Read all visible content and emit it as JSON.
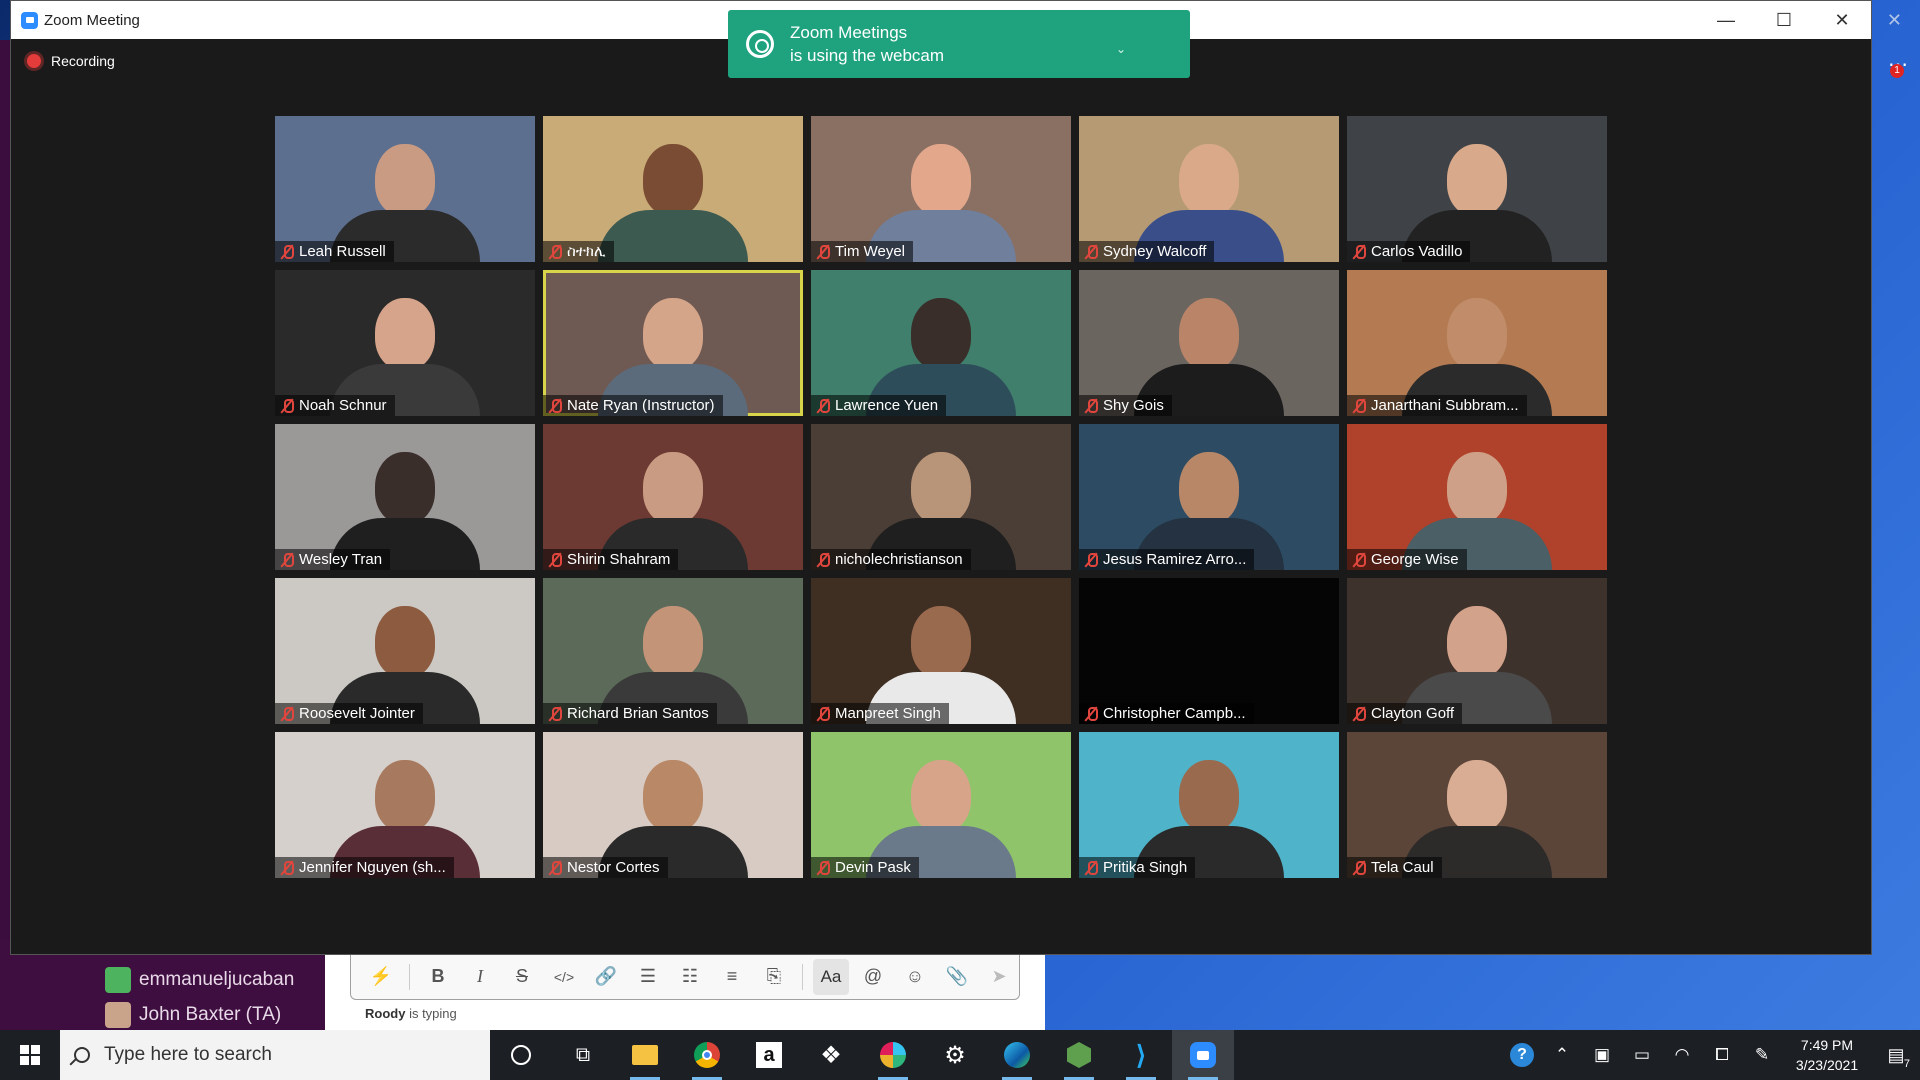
{
  "window": {
    "title": "Zoom Meeting"
  },
  "recording": {
    "label": "Recording"
  },
  "notification": {
    "line1": "Zoom Meetings",
    "line2": "is using the webcam"
  },
  "side_badge": "1",
  "participants": [
    {
      "name": "Leah Russell",
      "bg": "#5d6f8f",
      "head": "#c99b82",
      "body": "#2b2b2b"
    },
    {
      "name": "ስተክሊ",
      "bg": "#c9ab78",
      "head": "#7a4c33",
      "body": "#3c5a4f"
    },
    {
      "name": "Tim Weyel",
      "bg": "#8a6f63",
      "head": "#e3a88c",
      "body": "#6f7f9c"
    },
    {
      "name": "Sydney Walcoff",
      "bg": "#b59a74",
      "head": "#d9a98a",
      "body": "#3a4f8a"
    },
    {
      "name": "Carlos Vadillo",
      "bg": "#3f4347",
      "head": "#d8a98a",
      "body": "#222"
    },
    {
      "name": "Noah Schnur",
      "bg": "#2a2a2a",
      "head": "#d6a48a",
      "body": "#3a3a3a"
    },
    {
      "name": "Nate Ryan (Instructor)",
      "bg": "#6e5a53",
      "head": "#d5a58a",
      "body": "#5b6b7b"
    },
    {
      "name": "Lawrence Yuen",
      "bg": "#3f7f6c",
      "head": "#3a2e2a",
      "body": "#2e4d5a"
    },
    {
      "name": "Shy Gois",
      "bg": "#6b6560",
      "head": "#b98468",
      "body": "#1c1c1c"
    },
    {
      "name": "Janarthani Subbram...",
      "bg": "#b47b52",
      "head": "#c08c6a",
      "body": "#2b2b2b"
    },
    {
      "name": "Wesley Tran",
      "bg": "#9b9898",
      "head": "#3a2e2a",
      "body": "#1f1f1f"
    },
    {
      "name": "Shirin Shahram",
      "bg": "#6d3a33",
      "head": "#c99b82",
      "body": "#2a2a2a"
    },
    {
      "name": "nicholechristianson",
      "bg": "#4a3e36",
      "head": "#b89478",
      "body": "#1f1f1f"
    },
    {
      "name": "Jesus Ramirez Arro...",
      "bg": "#2d4c63",
      "head": "#b88767",
      "body": "#243241"
    },
    {
      "name": "George Wise",
      "bg": "#b0412a",
      "head": "#cfa088",
      "body": "#4a5f66"
    },
    {
      "name": "Roosevelt Jointer",
      "bg": "#ccc9c4",
      "head": "#8c5b40",
      "body": "#2a2a2a"
    },
    {
      "name": "Richard Brian Santos",
      "bg": "#5c6a5a",
      "head": "#c49479",
      "body": "#3a3a3a"
    },
    {
      "name": "Manpreet Singh",
      "bg": "#3f2e22",
      "head": "#9a6a4e",
      "body": "#e9e9e9"
    },
    {
      "name": "Christopher Campb...",
      "bg": "#050505",
      "head": "#050505",
      "body": "#050505"
    },
    {
      "name": "Clayton Goff",
      "bg": "#3e322c",
      "head": "#d3a28a",
      "body": "#4a4a4a"
    },
    {
      "name": "Jennifer Nguyen (sh...",
      "bg": "#d6d0cc",
      "head": "#a77a5f",
      "body": "#5a2e36"
    },
    {
      "name": "Nestor Cortes",
      "bg": "#d7cbc4",
      "head": "#b98866",
      "body": "#2a2a2a"
    },
    {
      "name": "Devin Pask",
      "bg": "#8fc46a",
      "head": "#d7a48a",
      "body": "#6a7a8a"
    },
    {
      "name": "Pritika Singh",
      "bg": "#4fb3c9",
      "head": "#9a6a4e",
      "body": "#2a2a2a"
    },
    {
      "name": "Tela Caul",
      "bg": "#5b4538",
      "head": "#d9ad94",
      "body": "#2d2a2a"
    }
  ],
  "active_speaker": "Nate Ryan (Instructor)",
  "slack": {
    "users": [
      "emmanueljucaban",
      "John Baxter (TA)"
    ],
    "typing_user": "Roody",
    "typing_suffix": " is typing",
    "format_label": "Aa"
  },
  "taskbar": {
    "search_placeholder": "Type here to search",
    "time": "7:49 PM",
    "date": "3/23/2021",
    "notification_count": "7"
  },
  "colors": {
    "zoom_blue": "#2d8cff",
    "notify_green": "#1fa37f",
    "record_red": "#e43b3b",
    "active_outline": "#d9d54a"
  }
}
